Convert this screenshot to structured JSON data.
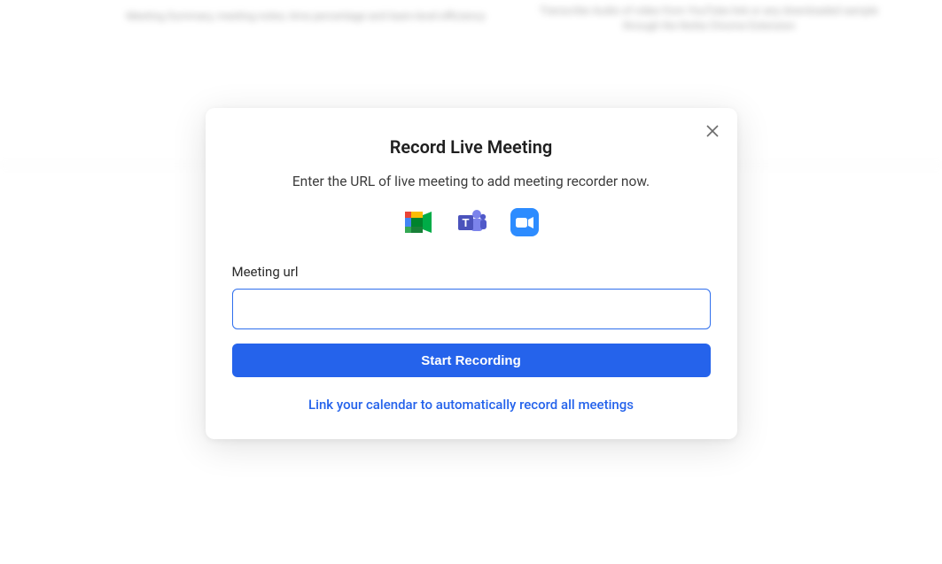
{
  "background": {
    "t2": "Meeting Summary, meeting notes, time percentage and team-level efficiency",
    "t3": "Transcribe Audio of video from YouTube link or any downloaded sample through the Notta Chrome Extension"
  },
  "modal": {
    "title": "Record Live Meeting",
    "subtitle": "Enter the URL of live meeting to add meeting recorder now.",
    "field_label": "Meeting url",
    "input_value": "",
    "start_button": "Start Recording",
    "link_calendar": "Link your calendar to automatically record all meetings"
  }
}
